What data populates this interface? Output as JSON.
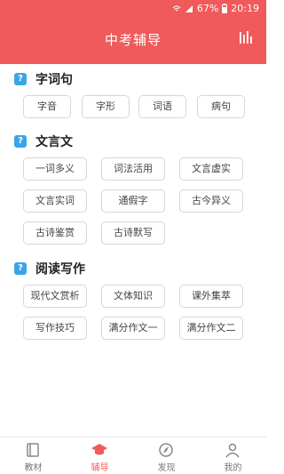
{
  "status_bar": {
    "battery": "67%",
    "time": "20:19"
  },
  "header": {
    "title": "中考辅导",
    "stats_icon": "bar-chart-icon"
  },
  "sections": [
    {
      "title": "字词句",
      "items": [
        "字音",
        "字形",
        "词语",
        "病句"
      ]
    },
    {
      "title": "文言文",
      "items": [
        "一词多义",
        "词法活用",
        "文言虚实",
        "文言实词",
        "通假字",
        "古今异义",
        "古诗鉴赏",
        "古诗默写"
      ]
    },
    {
      "title": "阅读写作",
      "items": [
        "现代文赏析",
        "文体知识",
        "课外集萃",
        "写作技巧",
        "满分作文一",
        "满分作文二"
      ]
    }
  ],
  "tabs": [
    {
      "label": "教材",
      "icon": "book-icon",
      "active": false
    },
    {
      "label": "辅导",
      "icon": "graduation-cap-icon",
      "active": true
    },
    {
      "label": "发现",
      "icon": "compass-icon",
      "active": false
    },
    {
      "label": "我的",
      "icon": "person-icon",
      "active": false
    }
  ],
  "colors": {
    "primary": "#f05a5a",
    "section_icon": "#39a5e8"
  }
}
